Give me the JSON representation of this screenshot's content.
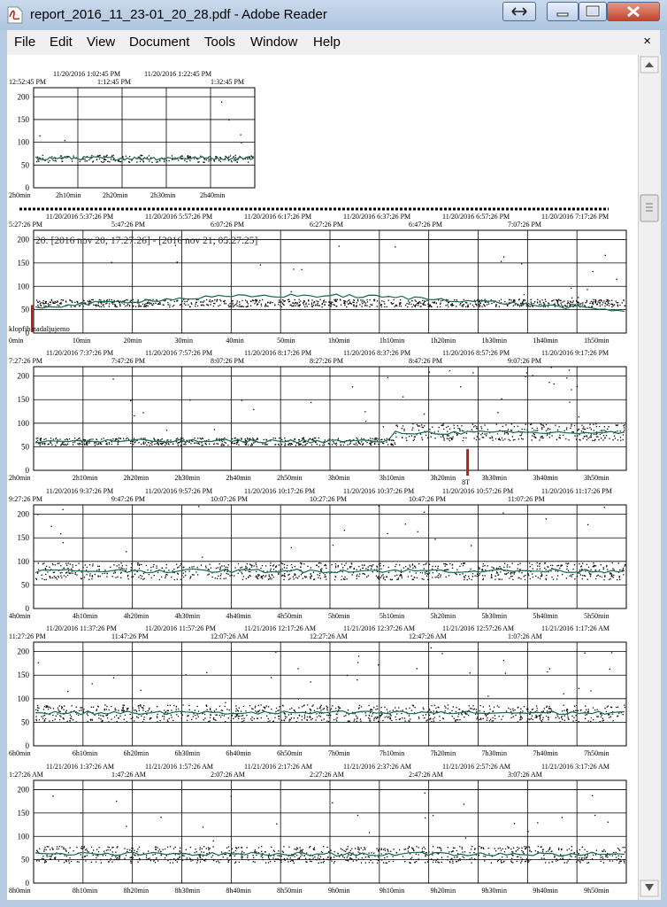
{
  "window": {
    "title": "report_2016_11_23-01_20_28.pdf - Adobe Reader",
    "icon": "pdf-icon",
    "controls": [
      "restore-icon",
      "minimize-icon",
      "maximize-icon",
      "close-icon"
    ]
  },
  "menu": {
    "items": [
      "File",
      "Edit",
      "View",
      "Document",
      "Tools",
      "Window",
      "Help"
    ],
    "close_glyph": "×"
  },
  "colors": {
    "trend": "#2f9a72",
    "marker": "#b2211c",
    "grid": "#000000",
    "points": "#000000"
  },
  "charts": [
    {
      "top_labels": [
        "11/20/2016 1:02:45 PM",
        "11/20/2016 1:22:45 PM"
      ],
      "time_labels": [
        "12:52:45 PM",
        "1:12:45 PM",
        "1:32:45 PM"
      ],
      "x_ticks": [
        "2h0min",
        "2h10min",
        "2h20min",
        "2h30min",
        "2h40min"
      ],
      "y_ticks": [
        "0",
        "50",
        "100",
        "150",
        "200"
      ],
      "level": 65
    },
    {
      "top_labels": [
        "11/20/2016 5:37:26 PM",
        "11/20/2016 5:57:26 PM",
        "11/20/2016 6:17:26 PM",
        "11/20/2016 6:37:26 PM",
        "11/20/2016 6:57:26 PM",
        "11/20/2016 7:17:26 PM"
      ],
      "time_labels": [
        "5:27:26 PM",
        "5:47:26 PM",
        "6:07:26 PM",
        "6:27:26 PM",
        "6:47:26 PM",
        "7:07:26 PM"
      ],
      "x_ticks": [
        "0min",
        "10min",
        "20min",
        "30min",
        "40min",
        "50min",
        "1h0min",
        "1h10min",
        "1h20min",
        "1h30min",
        "1h40min",
        "1h50min"
      ],
      "y_ticks": [
        "0",
        "50",
        "100",
        "150",
        "200"
      ],
      "level": 65,
      "annotation": "20: [2016 nov 20; 17:27:26] - [2016 nov 21; 05:27:25]",
      "marker_label": "klopfib nadaljujemo"
    },
    {
      "top_labels": [
        "11/20/2016 7:37:26 PM",
        "11/20/2016 7:57:26 PM",
        "11/20/2016 8:17:26 PM",
        "11/20/2016 8:37:26 PM",
        "11/20/2016 8:57:26 PM",
        "11/20/2016 9:17:26 PM"
      ],
      "time_labels": [
        "7:27:26 PM",
        "7:47:26 PM",
        "8:07:26 PM",
        "8:27:26 PM",
        "8:47:26 PM",
        "9:07:26 PM"
      ],
      "x_ticks": [
        "2h0min",
        "2h10min",
        "2h20min",
        "2h30min",
        "2h40min",
        "2h50min",
        "3h0min",
        "3h10min",
        "3h20min",
        "3h30min",
        "3h40min",
        "3h50min"
      ],
      "y_ticks": [
        "0",
        "50",
        "100",
        "150",
        "200"
      ],
      "level": 62,
      "marker_label": "8T"
    },
    {
      "top_labels": [
        "11/20/2016 9:37:26 PM",
        "11/20/2016 9:57:26 PM",
        "11/20/2016 10:17:26 PM",
        "11/20/2016 10:37:26 PM",
        "11/20/2016 10:57:26 PM",
        "11/20/2016 11:17:26 PM"
      ],
      "time_labels": [
        "9:27:26 PM",
        "9:47:26 PM",
        "10:07:26 PM",
        "10:27:26 PM",
        "10:47:26 PM",
        "11:07:26 PM"
      ],
      "x_ticks": [
        "4h0min",
        "4h10min",
        "4h20min",
        "4h30min",
        "4h40min",
        "4h50min",
        "5h0min",
        "5h10min",
        "5h20min",
        "5h30min",
        "5h40min",
        "5h50min"
      ],
      "y_ticks": [
        "0",
        "50",
        "100",
        "150",
        "200"
      ],
      "level": 80
    },
    {
      "top_labels": [
        "11/20/2016 11:37:26 PM",
        "11/20/2016 11:57:26 PM",
        "11/21/2016 12:17:26 AM",
        "11/21/2016 12:37:26 AM",
        "11/21/2016 12:57:26 AM",
        "11/21/2016 1:17:26 AM"
      ],
      "time_labels": [
        "11:27:26 PM",
        "11:47:26 PM",
        "12:07:26 AM",
        "12:27:26 AM",
        "12:47:26 AM",
        "1:07:26 AM"
      ],
      "x_ticks": [
        "6h0min",
        "6h10min",
        "6h20min",
        "6h30min",
        "6h40min",
        "6h50min",
        "7h0min",
        "7h10min",
        "7h20min",
        "7h30min",
        "7h40min",
        "7h50min"
      ],
      "y_ticks": [
        "0",
        "50",
        "100",
        "150",
        "200"
      ],
      "level": 70
    },
    {
      "top_labels": [
        "11/21/2016 1:37:26 AM",
        "11/21/2016 1:57:26 AM",
        "11/21/2016 2:17:26 AM",
        "11/21/2016 2:37:26 AM",
        "11/21/2016 2:57:26 AM",
        "11/21/2016 3:17:26 AM"
      ],
      "time_labels": [
        "1:27:26 AM",
        "1:47:26 AM",
        "2:07:26 AM",
        "2:27:26 AM",
        "2:47:26 AM",
        "3:07:26 AM"
      ],
      "x_ticks": [
        "8h0min",
        "8h10min",
        "8h20min",
        "8h30min",
        "8h40min",
        "8h50min",
        "9h0min",
        "9h10min",
        "9h20min",
        "9h30min",
        "9h40min",
        "9h50min"
      ],
      "y_ticks": [
        "0",
        "50",
        "100",
        "150",
        "200"
      ],
      "level": 62
    }
  ]
}
